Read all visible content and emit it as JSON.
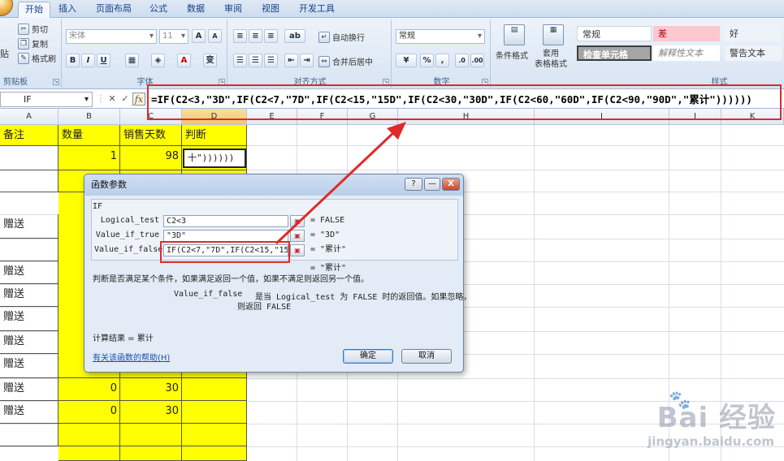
{
  "ribbon_tabs": [
    "开始",
    "插入",
    "页面布局",
    "公式",
    "数据",
    "审阅",
    "视图",
    "开发工具"
  ],
  "clipboard": {
    "paste": "贴",
    "cut": "剪切",
    "copy": "复制",
    "format_painter": "格式刷",
    "label": "剪贴板"
  },
  "font": {
    "name": "宋体",
    "size": "11",
    "bold": "B",
    "italic": "I",
    "underline": "U",
    "grow": "A",
    "shrink": "A",
    "color": "A",
    "wen": "变",
    "label": "字体"
  },
  "alignment": {
    "wrap": "自动换行",
    "merge": "合并后居中",
    "label": "对齐方式"
  },
  "number": {
    "format": "常规",
    "percent": "%",
    "comma": ",",
    "label": "数字"
  },
  "styles": {
    "conditional": "条件格式",
    "table": "套用\n表格格式",
    "normal": "常规",
    "bad": "差",
    "good": "好",
    "check": "检查单元格",
    "explain": "解释性文本",
    "warn": "警告文本",
    "label": "样式"
  },
  "formula_bar": {
    "name_box": "IF",
    "cancel": "✕",
    "enter": "✓",
    "fx": "fx",
    "formula": "=IF(C2<3,\"3D\",IF(C2<7,\"7D\",IF(C2<15,\"15D\",IF(C2<30,\"30D\",IF(C2<60,\"60D\",IF(C2<90,\"90D\",\"累计\"))))))"
  },
  "columns": [
    "A",
    "B",
    "C",
    "D",
    "E",
    "F",
    "G",
    "H",
    "I",
    "J",
    "K"
  ],
  "sheet": {
    "headers": {
      "a": "备注",
      "b": "数量",
      "c": "销售天数",
      "d": "判断"
    },
    "row2": {
      "b": "1",
      "c": "98",
      "d": "十\"))))))"
    },
    "col_a": [
      "",
      "",
      "赠送",
      "",
      "赠送",
      "赠送",
      "赠送",
      "赠送",
      "赠送",
      "赠送",
      "赠送"
    ],
    "row_b_vals": [
      "0",
      "0"
    ],
    "row_c_vals": [
      "30",
      "30"
    ]
  },
  "dialog": {
    "title": "函数参数",
    "help_btn": "?",
    "min_btn": "—",
    "close_btn": "X",
    "function_name": "IF",
    "args": [
      {
        "label": "Logical_test",
        "value": "C2<3",
        "result": "= FALSE"
      },
      {
        "label": "Value_if_true",
        "value": "\"3D\"",
        "result": "= \"3D\""
      },
      {
        "label": "Value_if_false",
        "value": "IF(C2<7,\"7D\",IF(C2<15,\"15D\",",
        "result": "= \"累计\""
      }
    ],
    "overall_result": "= \"累计\"",
    "description": "判断是否满足某个条件，如果满足返回一个值，如果不满足则返回另一个值。",
    "arg_help_name": "Value_if_false",
    "arg_help_text": "是当 Logical_test 为 FALSE 时的返回值。如果忽略，",
    "arg_help_text2": "则返回 FALSE",
    "calc_result": "计算结果 =  累计",
    "help_link": "有关该函数的帮助(H)",
    "ok": "确定",
    "cancel": "取消"
  },
  "watermark": {
    "brand": "Bai 经验",
    "url": "jingyan.baidu.com"
  },
  "colors": {
    "highlight": "#ffff00",
    "annotation": "#e02a2a",
    "link": "#1a4fb0"
  }
}
